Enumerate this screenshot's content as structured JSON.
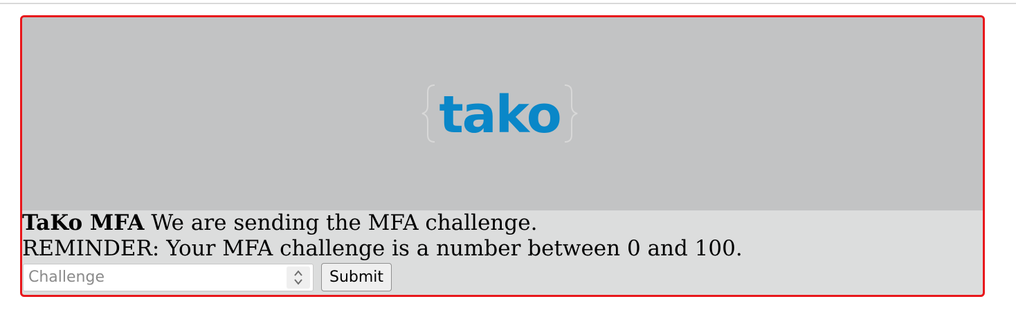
{
  "logo": {
    "brand_text": "tako",
    "brand_color": "#0a87c8",
    "bracket_color": "#d8d8d8",
    "banner_color": "#c2c3c4"
  },
  "message": {
    "brand_bold": "TaKo MFA",
    "sending_text": " We are sending the MFA challenge.",
    "reminder_text": "REMINDER: Your MFA challenge is a number between 0 and 100."
  },
  "form": {
    "challenge_placeholder": "Challenge",
    "challenge_value": "",
    "submit_label": "Submit"
  },
  "colors": {
    "card_border": "#e8171b",
    "card_background": "#dcdddd"
  }
}
